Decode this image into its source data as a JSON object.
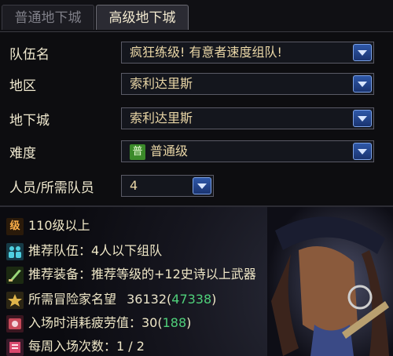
{
  "tabs": {
    "normal_dungeon": "普通地下城",
    "advanced_dungeon": "高级地下城"
  },
  "form": {
    "team_name_label": "队伍名",
    "team_name_value": "疯狂练级! 有意者速度组队!",
    "region_label": "地区",
    "region_value": "索利达里斯",
    "dungeon_label": "地下城",
    "dungeon_value": "索利达里斯",
    "difficulty_label": "难度",
    "difficulty_badge": "普",
    "difficulty_value": "普通级",
    "members_label": "人员/所需队员",
    "members_value": "4"
  },
  "info": {
    "level_icon": "级",
    "level_text": "110级以上",
    "team_text": "推荐队伍：4人以下组队",
    "equip_text": "推荐装备：推荐等级的+12史诗以上武器",
    "fame_label": "所需冒险家名望",
    "fame_required": "36132",
    "fame_current": "47338",
    "fatigue_label": "入场时消耗疲劳值：30",
    "fatigue_current": "188",
    "weekly_text": "每周入场次数：1 / 2"
  },
  "colors": {
    "accent_blue": "#2f58a8",
    "value_green": "#4fd07a",
    "text_cream": "#efe7c7",
    "level_orange": "#ffb14a"
  },
  "icons": [
    "level-icon",
    "team-icon",
    "equip-icon",
    "fame-icon",
    "fatigue-icon",
    "weekly-icon",
    "dropdown-arrow-icon"
  ]
}
